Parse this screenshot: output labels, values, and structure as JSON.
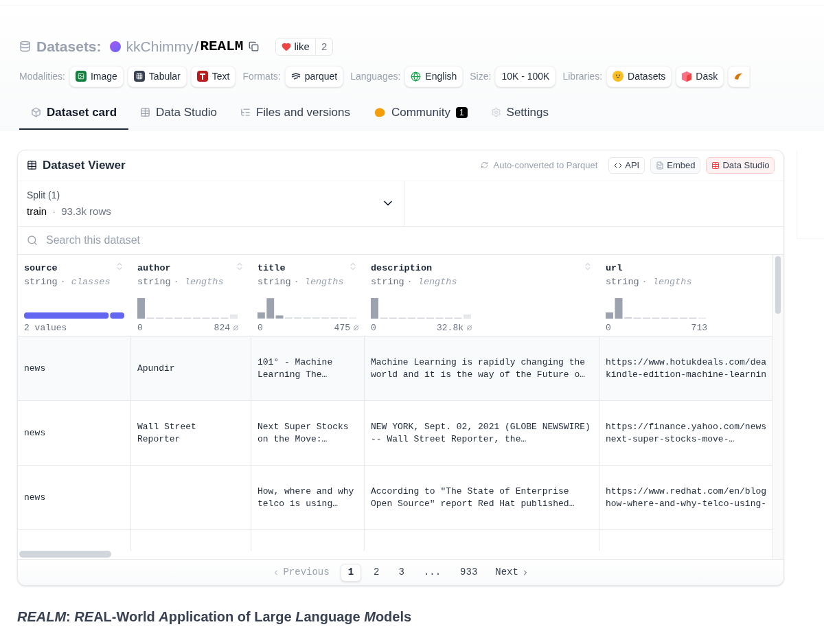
{
  "header": {
    "section": "Datasets:",
    "owner": "kkChimmy",
    "separator": "/",
    "name": "REALM",
    "like": {
      "label": "like",
      "count": "2"
    }
  },
  "tag_groups": [
    {
      "label": "Modalities:",
      "tags": [
        "Image",
        "Tabular",
        "Text"
      ]
    },
    {
      "label": "Formats:",
      "tags": [
        "parquet"
      ]
    },
    {
      "label": "Languages:",
      "tags": [
        "English"
      ]
    },
    {
      "label": "Size:",
      "tags": [
        "10K - 100K"
      ]
    },
    {
      "label": "Libraries:",
      "tags": [
        "Datasets",
        "Dask"
      ]
    }
  ],
  "tabs": [
    {
      "label": "Dataset card",
      "selected": true
    },
    {
      "label": "Data Studio",
      "selected": false
    },
    {
      "label": "Files and versions",
      "selected": false
    },
    {
      "label": "Community",
      "selected": false,
      "badge": "1"
    },
    {
      "label": "Settings",
      "selected": false
    }
  ],
  "viewer": {
    "title": "Dataset Viewer",
    "auto_converted": "Auto-converted to Parquet",
    "buttons": [
      {
        "kind": "api",
        "label": "API"
      },
      {
        "kind": "embed",
        "label": "Embed"
      },
      {
        "kind": "studio",
        "label": "Data Studio"
      }
    ],
    "split": {
      "label": "Split (1)",
      "value": "train",
      "separator": "·",
      "rows": "93.3k rows"
    },
    "search": {
      "placeholder": "Search this dataset"
    },
    "columns": [
      {
        "name": "source",
        "type": "string",
        "stat": "· classes",
        "kind": "classes",
        "footer": "2 values"
      },
      {
        "name": "author",
        "type": "string",
        "stat": "· lengths",
        "kind": "lengths",
        "min": "0",
        "max": "824",
        "nulls": true
      },
      {
        "name": "title",
        "type": "string",
        "stat": "· lengths",
        "kind": "lengths",
        "min": "0",
        "max": "475",
        "nulls": true
      },
      {
        "name": "description",
        "type": "string",
        "stat": "· lengths",
        "kind": "lengths",
        "min": "0",
        "max": "32.8k",
        "nulls": true
      },
      {
        "name": "url",
        "type": "string",
        "stat": "· lengths",
        "kind": "lengths",
        "min": "0",
        "max": "713",
        "nulls": false
      }
    ],
    "rows": [
      [
        "news",
        "Apundir",
        "101° - Machine Learning The…",
        "Machine Learning is rapidly changing the world and it is the way of the Future o…",
        "https://www.hotukdeals.com/dea kindle-edition-machine-learnin"
      ],
      [
        "news",
        "Wall Street Reporter",
        "Next Super Stocks on the Move:…",
        "NEW YORK, Sept. 02, 2021 (GLOBE NEWSWIRE) -- Wall Street Reporter, the…",
        "https://finance.yahoo.com/news next-super-stocks-move-…"
      ],
      [
        "news",
        "",
        "How, where and why telco is using…",
        "According to \"The State of Enterprise Open Source\" report Red Hat published…",
        "https://www.redhat.com/en/blog how-where-and-why-telco-using-"
      ]
    ],
    "pagination": {
      "previous": "Previous",
      "pages": [
        {
          "label": "1",
          "selected": true
        },
        {
          "label": "2",
          "selected": false
        },
        {
          "label": "3",
          "selected": false
        },
        {
          "label": "...",
          "selected": false
        },
        {
          "label": "933",
          "selected": false
        }
      ],
      "next": "Next"
    }
  },
  "heading": [
    {
      "text": "REALM",
      "italic": true
    },
    {
      "text": ": ",
      "italic": false
    },
    {
      "text": "RE",
      "italic": true
    },
    {
      "text": "AL-World ",
      "italic": false
    },
    {
      "text": "A",
      "italic": true
    },
    {
      "text": "pplication of Large ",
      "italic": false
    },
    {
      "text": "L",
      "italic": true
    },
    {
      "text": "anguage ",
      "italic": false
    },
    {
      "text": "M",
      "italic": true
    },
    {
      "text": "odels",
      "italic": false
    }
  ]
}
